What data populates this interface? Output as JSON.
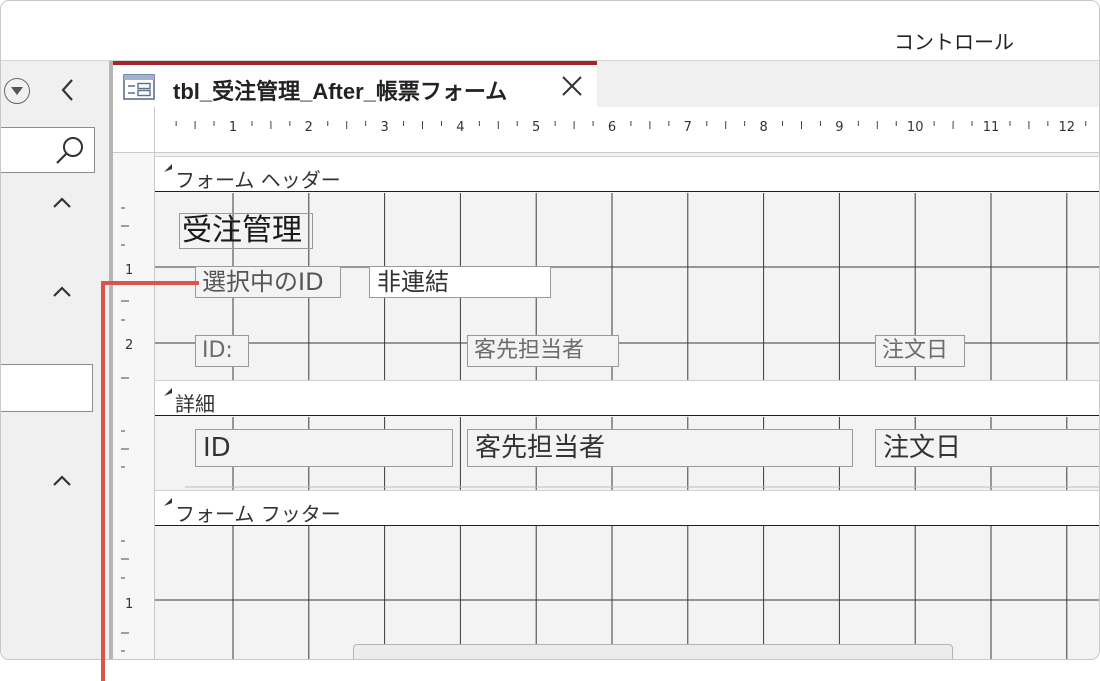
{
  "ribbon": {
    "group_label": "コントロール"
  },
  "tab": {
    "title": "tbl_受注管理_After_帳票フォーム",
    "close_glyph": "✕"
  },
  "ruler": {
    "ticks": [
      "1",
      "2",
      "3",
      "4",
      "5",
      "6",
      "7",
      "8",
      "9",
      "10",
      "11",
      "12"
    ],
    "v_numbers": [
      "1",
      "2",
      "1"
    ]
  },
  "sections": {
    "header": "フォーム ヘッダー",
    "detail": "詳細",
    "footer": "フォーム フッター"
  },
  "header_controls": {
    "title_label": "受注管理",
    "selected_id_label": "選択中のID",
    "selected_id_value": "非連結",
    "col_id": "ID:",
    "col_contact": "客先担当者",
    "col_date": "注文日"
  },
  "detail_controls": {
    "id": "ID",
    "contact": "客先担当者",
    "date": "注文日"
  },
  "colors": {
    "tab_accent": "#a4262c",
    "callout": "#d9554a"
  },
  "icons": {
    "nav_menu": "dropdown-circle-icon",
    "nav_back": "chevron-left-icon",
    "search": "search-icon",
    "caret": "chevron-up-icon",
    "form": "form-icon",
    "close": "close-icon"
  }
}
